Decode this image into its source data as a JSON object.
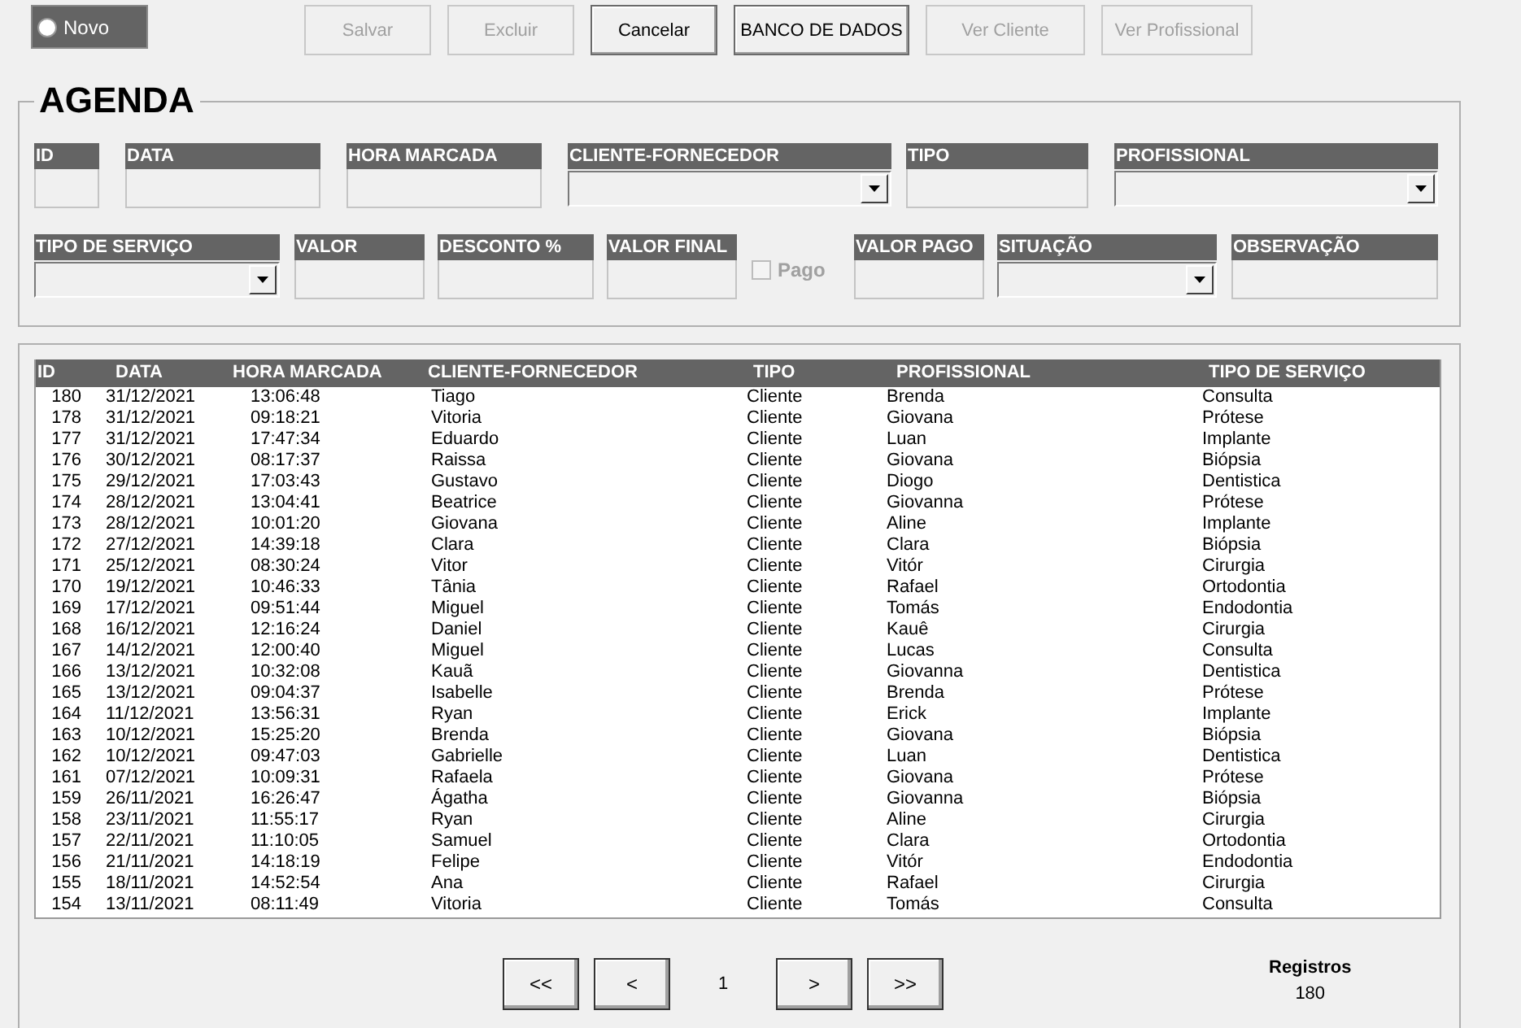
{
  "novo_option": {
    "label": "Novo",
    "selected": false
  },
  "toolbar": [
    {
      "label": "Salvar",
      "disabled": true
    },
    {
      "label": "Excluir",
      "disabled": true
    },
    {
      "label": "Cancelar",
      "disabled": false
    },
    {
      "label": "BANCO DE DADOS",
      "disabled": false
    },
    {
      "label": "Ver Cliente",
      "disabled": true
    },
    {
      "label": "Ver Profissional",
      "disabled": true
    }
  ],
  "form": {
    "title": "AGENDA",
    "fields": [
      {
        "label": "ID",
        "kind": "text"
      },
      {
        "label": "DATA",
        "kind": "text"
      },
      {
        "label": "HORA MARCADA",
        "kind": "text"
      },
      {
        "label": "CLIENTE-FORNECEDOR",
        "kind": "combo"
      },
      {
        "label": "TIPO",
        "kind": "text"
      },
      {
        "label": "PROFISSIONAL",
        "kind": "combo"
      },
      {
        "label": "TIPO DE SERVIÇO",
        "kind": "combo"
      },
      {
        "label": "VALOR",
        "kind": "text"
      },
      {
        "label": "DESCONTO %",
        "kind": "text"
      },
      {
        "label": "VALOR FINAL",
        "kind": "text"
      },
      {
        "label": "Pago",
        "kind": "checkbox",
        "checked": false,
        "disabled": true
      },
      {
        "label": "VALOR PAGO",
        "kind": "text"
      },
      {
        "label": "SITUAÇÃO",
        "kind": "combo"
      },
      {
        "label": "OBSERVAÇÃO",
        "kind": "text"
      }
    ]
  },
  "table": {
    "columns": [
      "ID",
      "DATA",
      "HORA MARCADA",
      "CLIENTE-FORNECEDOR",
      "TIPO",
      "PROFISSIONAL",
      "TIPO DE SERVIÇO"
    ],
    "rows": [
      [
        "180",
        "31/12/2021",
        "13:06:48",
        "Tiago",
        "Cliente",
        "Brenda",
        "Consulta"
      ],
      [
        "178",
        "31/12/2021",
        "09:18:21",
        "Vitoria",
        "Cliente",
        "Giovana",
        "Prótese"
      ],
      [
        "177",
        "31/12/2021",
        "17:47:34",
        "Eduardo",
        "Cliente",
        "Luan",
        "Implante"
      ],
      [
        "176",
        "30/12/2021",
        "08:17:37",
        "Raissa",
        "Cliente",
        "Giovana",
        "Biópsia"
      ],
      [
        "175",
        "29/12/2021",
        "17:03:43",
        "Gustavo",
        "Cliente",
        "Diogo",
        "Dentistica"
      ],
      [
        "174",
        "28/12/2021",
        "13:04:41",
        "Beatrice",
        "Cliente",
        "Giovanna",
        "Prótese"
      ],
      [
        "173",
        "28/12/2021",
        "10:01:20",
        "Giovana",
        "Cliente",
        "Aline",
        "Implante"
      ],
      [
        "172",
        "27/12/2021",
        "14:39:18",
        "Clara",
        "Cliente",
        "Clara",
        "Biópsia"
      ],
      [
        "171",
        "25/12/2021",
        "08:30:24",
        "Vitor",
        "Cliente",
        "Vitór",
        "Cirurgia"
      ],
      [
        "170",
        "19/12/2021",
        "10:46:33",
        "Tânia",
        "Cliente",
        "Rafael",
        "Ortodontia"
      ],
      [
        "169",
        "17/12/2021",
        "09:51:44",
        "Miguel",
        "Cliente",
        "Tomás",
        "Endodontia"
      ],
      [
        "168",
        "16/12/2021",
        "12:16:24",
        "Daniel",
        "Cliente",
        "Kauê",
        "Cirurgia"
      ],
      [
        "167",
        "14/12/2021",
        "12:00:40",
        "Miguel",
        "Cliente",
        "Lucas",
        "Consulta"
      ],
      [
        "166",
        "13/12/2021",
        "10:32:08",
        "Kauã",
        "Cliente",
        "Giovanna",
        "Dentistica"
      ],
      [
        "165",
        "13/12/2021",
        "09:04:37",
        "Isabelle",
        "Cliente",
        "Brenda",
        "Prótese"
      ],
      [
        "164",
        "11/12/2021",
        "13:56:31",
        "Ryan",
        "Cliente",
        "Erick",
        "Implante"
      ],
      [
        "163",
        "10/12/2021",
        "15:25:20",
        "Brenda",
        "Cliente",
        "Giovana",
        "Biópsia"
      ],
      [
        "162",
        "10/12/2021",
        "09:47:03",
        "Gabrielle",
        "Cliente",
        "Luan",
        "Dentistica"
      ],
      [
        "161",
        "07/12/2021",
        "10:09:31",
        "Rafaela",
        "Cliente",
        "Giovana",
        "Prótese"
      ],
      [
        "159",
        "26/11/2021",
        "16:26:47",
        "Ágatha",
        "Cliente",
        "Giovanna",
        "Biópsia"
      ],
      [
        "158",
        "23/11/2021",
        "11:55:17",
        "Ryan",
        "Cliente",
        "Aline",
        "Cirurgia"
      ],
      [
        "157",
        "22/11/2021",
        "11:10:05",
        "Samuel",
        "Cliente",
        "Clara",
        "Ortodontia"
      ],
      [
        "156",
        "21/11/2021",
        "14:18:19",
        "Felipe",
        "Cliente",
        "Vitór",
        "Endodontia"
      ],
      [
        "155",
        "18/11/2021",
        "14:52:54",
        "Ana",
        "Cliente",
        "Rafael",
        "Cirurgia"
      ],
      [
        "154",
        "13/11/2021",
        "08:11:49",
        "Vitoria",
        "Cliente",
        "Tomás",
        "Consulta"
      ]
    ]
  },
  "pagination": {
    "first": "<<",
    "prev": "<",
    "page": "1",
    "next": ">",
    "last": ">>"
  },
  "records": {
    "label": "Registros",
    "count": "180"
  }
}
